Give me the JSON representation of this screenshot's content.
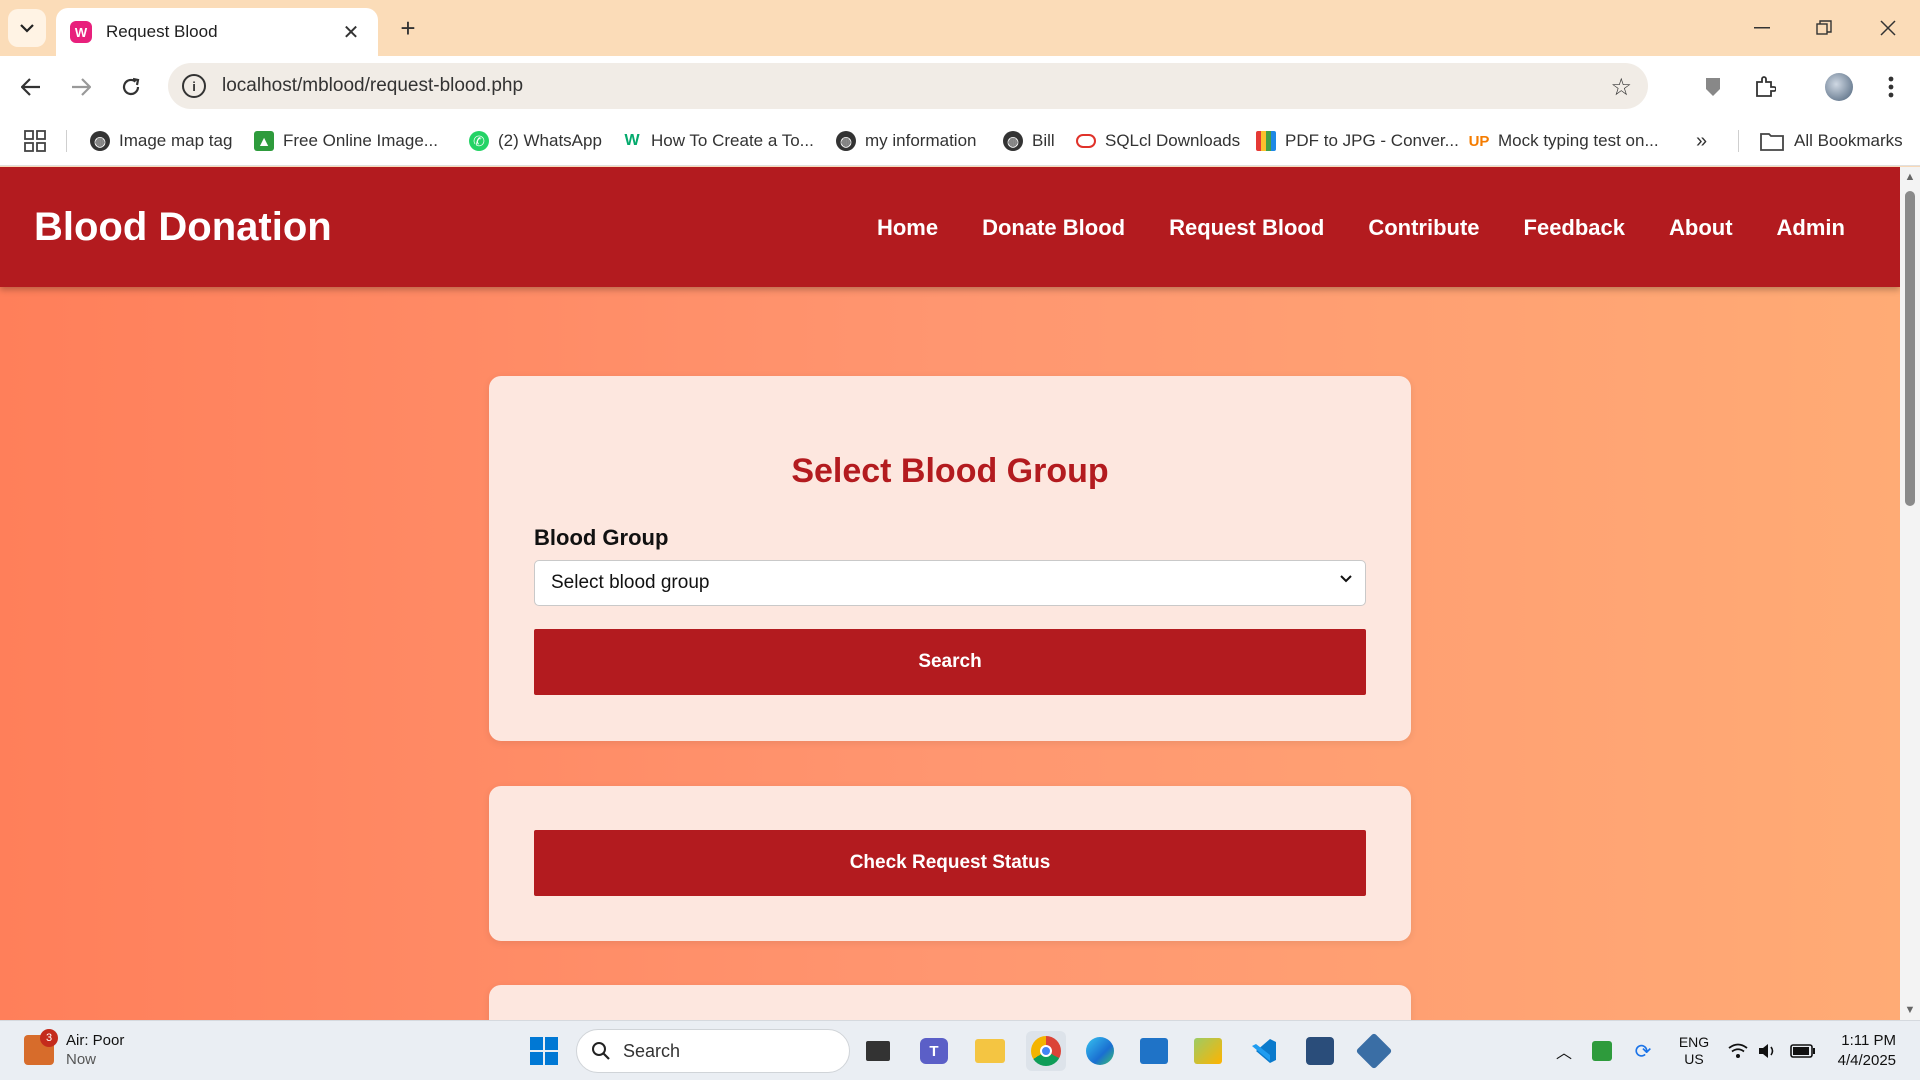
{
  "browser": {
    "tab_title": "Request Blood",
    "tab_favicon_letter": "W",
    "url": "localhost/mblood/request-blood.php",
    "bookmarks": [
      {
        "label": "Image map tag",
        "icon": "globe-icon"
      },
      {
        "label": "Free Online Image...",
        "icon": "image-icon"
      },
      {
        "label": "(2) WhatsApp",
        "icon": "whatsapp-icon"
      },
      {
        "label": "How To Create a To...",
        "icon": "w3-icon"
      },
      {
        "label": "my information",
        "icon": "globe-icon"
      },
      {
        "label": "Bill",
        "icon": "globe-icon"
      },
      {
        "label": "SQLcl Downloads",
        "icon": "oracle-icon"
      },
      {
        "label": "PDF to JPG - Conver...",
        "icon": "pdf-icon"
      },
      {
        "label": "Mock typing test on...",
        "icon": "up-icon"
      }
    ],
    "all_bookmarks_label": "All Bookmarks"
  },
  "site": {
    "brand": "Blood Donation",
    "nav": [
      "Home",
      "Donate Blood",
      "Request Blood",
      "Contribute",
      "Feedback",
      "About",
      "Admin"
    ],
    "accent_color": "#b31b1f"
  },
  "form": {
    "title": "Select Blood Group",
    "field_label": "Blood Group",
    "select_value": "Select blood group",
    "search_button": "Search"
  },
  "status": {
    "button": "Check Request Status"
  },
  "taskbar": {
    "weather_title": "Air: Poor",
    "weather_sub": "Now",
    "weather_badge": "3",
    "search_placeholder": "Search",
    "lang_top": "ENG",
    "lang_bottom": "US",
    "time": "1:11 PM",
    "date": "4/4/2025"
  }
}
